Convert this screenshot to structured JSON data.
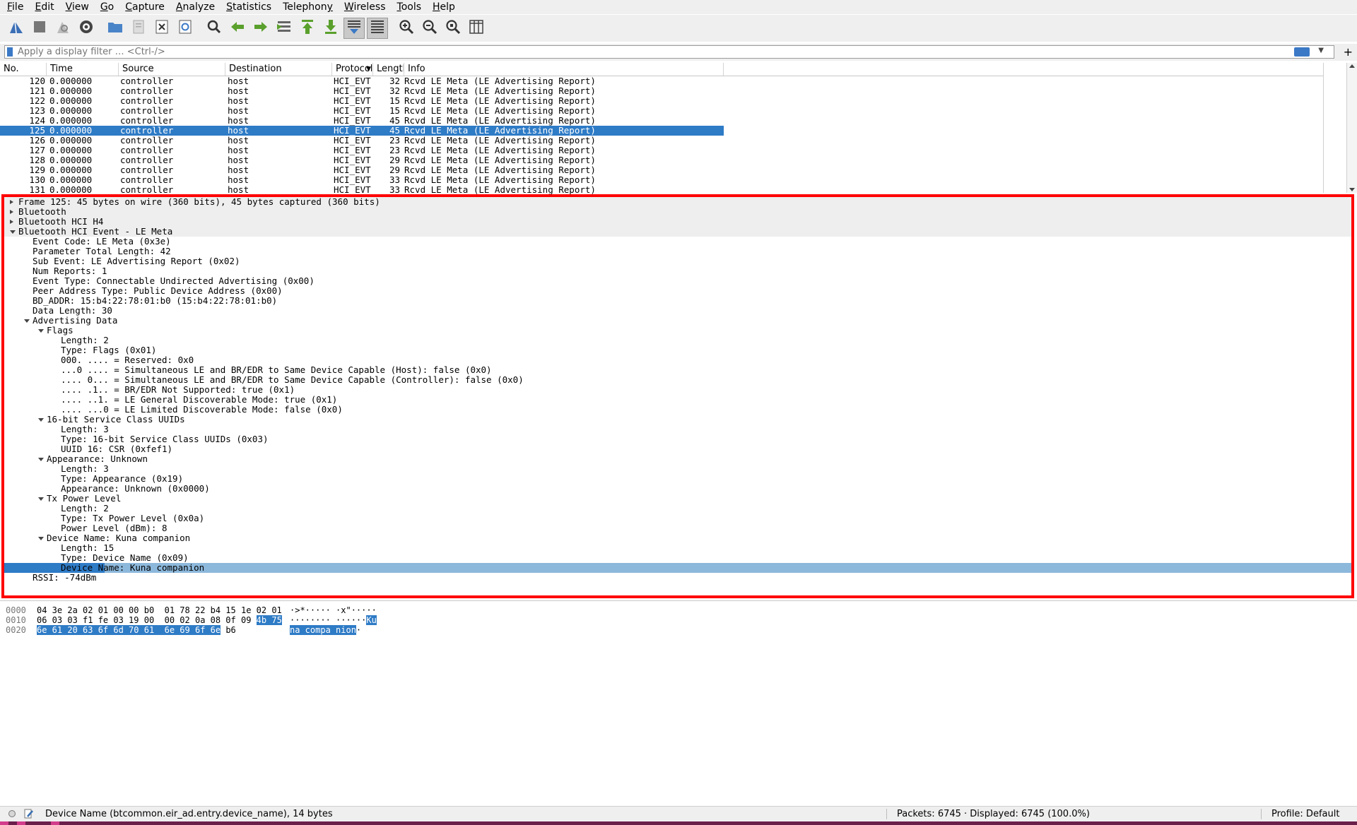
{
  "menu": [
    {
      "label": "File",
      "u": "F",
      "rest": "ile"
    },
    {
      "label": "Edit",
      "u": "E",
      "rest": "dit"
    },
    {
      "label": "View",
      "u": "V",
      "rest": "iew"
    },
    {
      "label": "Go",
      "u": "G",
      "rest": "o"
    },
    {
      "label": "Capture",
      "u": "C",
      "rest": "apture"
    },
    {
      "label": "Analyze",
      "u": "A",
      "rest": "nalyze"
    },
    {
      "label": "Statistics",
      "u": "S",
      "rest": "tatistics"
    },
    {
      "label": "Telephony",
      "u": "y",
      "rest": "Telephon"
    },
    {
      "label": "Wireless",
      "u": "W",
      "rest": "ireless"
    },
    {
      "label": "Tools",
      "u": "T",
      "rest": "ools"
    },
    {
      "label": "Help",
      "u": "H",
      "rest": "elp"
    }
  ],
  "filter": {
    "placeholder": "Apply a display filter … <Ctrl-/>"
  },
  "packet_list": {
    "columns": [
      "No.",
      "Time",
      "Source",
      "Destination",
      "Protocol",
      "Length",
      "Info"
    ],
    "rows": [
      {
        "no": "120",
        "time": "0.000000",
        "src": "controller",
        "dst": "host",
        "proto": "HCI_EVT",
        "len": "32",
        "info": "Rcvd LE Meta (LE Advertising Report)"
      },
      {
        "no": "121",
        "time": "0.000000",
        "src": "controller",
        "dst": "host",
        "proto": "HCI_EVT",
        "len": "32",
        "info": "Rcvd LE Meta (LE Advertising Report)"
      },
      {
        "no": "122",
        "time": "0.000000",
        "src": "controller",
        "dst": "host",
        "proto": "HCI_EVT",
        "len": "15",
        "info": "Rcvd LE Meta (LE Advertising Report)"
      },
      {
        "no": "123",
        "time": "0.000000",
        "src": "controller",
        "dst": "host",
        "proto": "HCI_EVT",
        "len": "15",
        "info": "Rcvd LE Meta (LE Advertising Report)"
      },
      {
        "no": "124",
        "time": "0.000000",
        "src": "controller",
        "dst": "host",
        "proto": "HCI_EVT",
        "len": "45",
        "info": "Rcvd LE Meta (LE Advertising Report)"
      },
      {
        "no": "125",
        "time": "0.000000",
        "src": "controller",
        "dst": "host",
        "proto": "HCI_EVT",
        "len": "45",
        "info": "Rcvd LE Meta (LE Advertising Report)",
        "selected": true
      },
      {
        "no": "126",
        "time": "0.000000",
        "src": "controller",
        "dst": "host",
        "proto": "HCI_EVT",
        "len": "23",
        "info": "Rcvd LE Meta (LE Advertising Report)"
      },
      {
        "no": "127",
        "time": "0.000000",
        "src": "controller",
        "dst": "host",
        "proto": "HCI_EVT",
        "len": "23",
        "info": "Rcvd LE Meta (LE Advertising Report)"
      },
      {
        "no": "128",
        "time": "0.000000",
        "src": "controller",
        "dst": "host",
        "proto": "HCI_EVT",
        "len": "29",
        "info": "Rcvd LE Meta (LE Advertising Report)"
      },
      {
        "no": "129",
        "time": "0.000000",
        "src": "controller",
        "dst": "host",
        "proto": "HCI_EVT",
        "len": "29",
        "info": "Rcvd LE Meta (LE Advertising Report)"
      },
      {
        "no": "130",
        "time": "0.000000",
        "src": "controller",
        "dst": "host",
        "proto": "HCI_EVT",
        "len": "33",
        "info": "Rcvd LE Meta (LE Advertising Report)"
      },
      {
        "no": "131",
        "time": "0.000000",
        "src": "controller",
        "dst": "host",
        "proto": "HCI_EVT",
        "len": "33",
        "info": "Rcvd LE Meta (LE Advertising Report)"
      }
    ]
  },
  "details": [
    {
      "level": 0,
      "tw": "closed",
      "text": "Frame 125: 45 bytes on wire (360 bits), 45 bytes captured (360 bits)",
      "top": true
    },
    {
      "level": 0,
      "tw": "closed",
      "text": "Bluetooth",
      "top": true
    },
    {
      "level": 0,
      "tw": "closed",
      "text": "Bluetooth HCI H4",
      "top": true
    },
    {
      "level": 0,
      "tw": "open",
      "text": "Bluetooth HCI Event - LE Meta",
      "top": true
    },
    {
      "level": 1,
      "text": "Event Code: LE Meta (0x3e)"
    },
    {
      "level": 1,
      "text": "Parameter Total Length: 42"
    },
    {
      "level": 1,
      "text": "Sub Event: LE Advertising Report (0x02)"
    },
    {
      "level": 1,
      "text": "Num Reports: 1"
    },
    {
      "level": 1,
      "text": "Event Type: Connectable Undirected Advertising (0x00)"
    },
    {
      "level": 1,
      "text": "Peer Address Type: Public Device Address (0x00)"
    },
    {
      "level": 1,
      "text": "BD_ADDR: 15:b4:22:78:01:b0 (15:b4:22:78:01:b0)"
    },
    {
      "level": 1,
      "text": "Data Length: 30"
    },
    {
      "level": 1,
      "tw": "open",
      "text": "Advertising Data"
    },
    {
      "level": 2,
      "tw": "open",
      "text": "Flags"
    },
    {
      "level": 3,
      "text": "Length: 2"
    },
    {
      "level": 3,
      "text": "Type: Flags (0x01)"
    },
    {
      "level": 3,
      "text": "000. .... = Reserved: 0x0"
    },
    {
      "level": 3,
      "text": "...0 .... = Simultaneous LE and BR/EDR to Same Device Capable (Host): false (0x0)"
    },
    {
      "level": 3,
      "text": ".... 0... = Simultaneous LE and BR/EDR to Same Device Capable (Controller): false (0x0)"
    },
    {
      "level": 3,
      "text": ".... .1.. = BR/EDR Not Supported: true (0x1)"
    },
    {
      "level": 3,
      "text": ".... ..1. = LE General Discoverable Mode: true (0x1)"
    },
    {
      "level": 3,
      "text": ".... ...0 = LE Limited Discoverable Mode: false (0x0)"
    },
    {
      "level": 2,
      "tw": "open",
      "text": "16-bit Service Class UUIDs"
    },
    {
      "level": 3,
      "text": "Length: 3"
    },
    {
      "level": 3,
      "text": "Type: 16-bit Service Class UUIDs (0x03)"
    },
    {
      "level": 3,
      "text": "UUID 16: CSR (0xfef1)"
    },
    {
      "level": 2,
      "tw": "open",
      "text": "Appearance: Unknown"
    },
    {
      "level": 3,
      "text": "Length: 3"
    },
    {
      "level": 3,
      "text": "Type: Appearance (0x19)"
    },
    {
      "level": 3,
      "text": "Appearance: Unknown (0x0000)"
    },
    {
      "level": 2,
      "tw": "open",
      "text": "Tx Power Level"
    },
    {
      "level": 3,
      "text": "Length: 2"
    },
    {
      "level": 3,
      "text": "Type: Tx Power Level (0x0a)"
    },
    {
      "level": 3,
      "text": "Power Level (dBm): 8"
    },
    {
      "level": 2,
      "tw": "open",
      "text": "Device Name: Kuna companion"
    },
    {
      "level": 3,
      "text": "Length: 15"
    },
    {
      "level": 3,
      "text": "Type: Device Name (0x09)"
    },
    {
      "level": 3,
      "text": "Device Name: Kuna companion",
      "highlight": true
    },
    {
      "level": 1,
      "text": "RSSI: -74dBm"
    }
  ],
  "bytes": [
    {
      "offset": "0000",
      "hex": [
        {
          "t": "04 3e 2a 02 01 00 00 b0  01 78 22 b4 15 1e 02 01"
        }
      ],
      "ascii": [
        {
          "t": "·>*····· ·x\"·····"
        }
      ]
    },
    {
      "offset": "0010",
      "hex": [
        {
          "t": "06 03 03 f1 fe 03 19 00  00 02 0a 08 0f 09 "
        },
        {
          "t": "4b 75",
          "sel": true
        }
      ],
      "ascii": [
        {
          "t": "········ ······"
        },
        {
          "t": "Ku",
          "sel": true
        }
      ]
    },
    {
      "offset": "0020",
      "hex": [
        {
          "t": "6e 61 20 63 6f 6d 70 61  6e 69 6f 6e",
          "sel": true
        },
        {
          "t": " b6"
        }
      ],
      "ascii": [
        {
          "t": "na compa nion",
          "sel": true
        },
        {
          "t": "·"
        }
      ]
    }
  ],
  "status": {
    "field": "Device Name (btcommon.eir_ad.entry.device_name), 14 bytes",
    "packets": "Packets: 6745 · Displayed: 6745 (100.0%)",
    "profile": "Profile: Default"
  },
  "colors": {
    "selection": "#2e7bc6",
    "highlight": "#8cb8db",
    "frame_outline": "#ff0000"
  }
}
